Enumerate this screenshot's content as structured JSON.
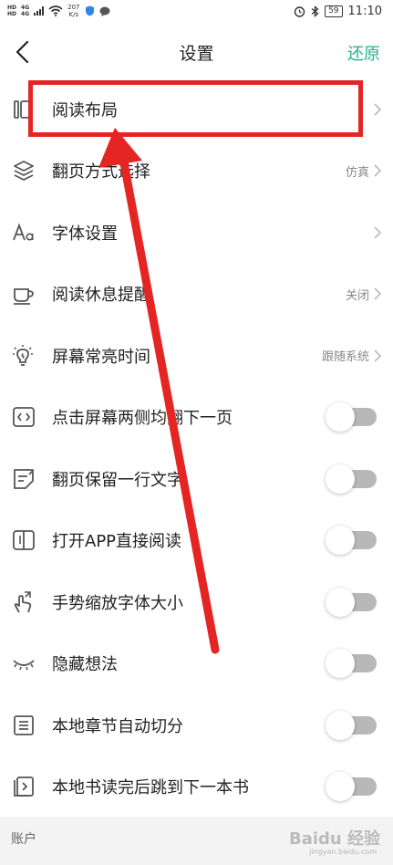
{
  "status_bar": {
    "sim1": "HD",
    "sim2": "HD",
    "network1": "4G",
    "network2": "4G",
    "speed_value": "207",
    "speed_unit": "K/s",
    "battery": "59",
    "time": "11:10"
  },
  "nav": {
    "title": "设置",
    "restore": "还原"
  },
  "settings": [
    {
      "label": "阅读布局",
      "icon": "reading-layout-icon",
      "control": "chevron",
      "value": ""
    },
    {
      "label": "翻页方式选择",
      "icon": "layers-icon",
      "control": "chevron",
      "value": "仿真"
    },
    {
      "label": "字体设置",
      "icon": "font-icon",
      "control": "chevron",
      "value": ""
    },
    {
      "label": "阅读休息提醒",
      "icon": "cup-icon",
      "control": "chevron",
      "value": "关闭"
    },
    {
      "label": "屏幕常亮时间",
      "icon": "bulb-icon",
      "control": "chevron",
      "value": "跟随系统"
    },
    {
      "label": "点击屏幕两侧均翻下一页",
      "icon": "code-icon",
      "control": "toggle",
      "on": false
    },
    {
      "label": "翻页保留一行文字",
      "icon": "note-icon",
      "control": "toggle",
      "on": false
    },
    {
      "label": "打开APP直接阅读",
      "icon": "book-icon",
      "control": "toggle",
      "on": false
    },
    {
      "label": "手势缩放字体大小",
      "icon": "gesture-icon",
      "control": "toggle",
      "on": false
    },
    {
      "label": "隐藏想法",
      "icon": "eye-closed-icon",
      "control": "toggle",
      "on": false
    },
    {
      "label": "本地章节自动切分",
      "icon": "list-icon",
      "control": "toggle",
      "on": false
    },
    {
      "label": "本地书读完后跳到下一本书",
      "icon": "next-book-icon",
      "control": "toggle",
      "on": false
    }
  ],
  "account": {
    "label": "账户"
  },
  "watermark": {
    "text": "Baidu 经验",
    "sub": "jingyan.baidu.com"
  },
  "colors": {
    "accent": "#27b08a",
    "annotation": "#e52424",
    "toggle_off": "#b8b8b8"
  }
}
